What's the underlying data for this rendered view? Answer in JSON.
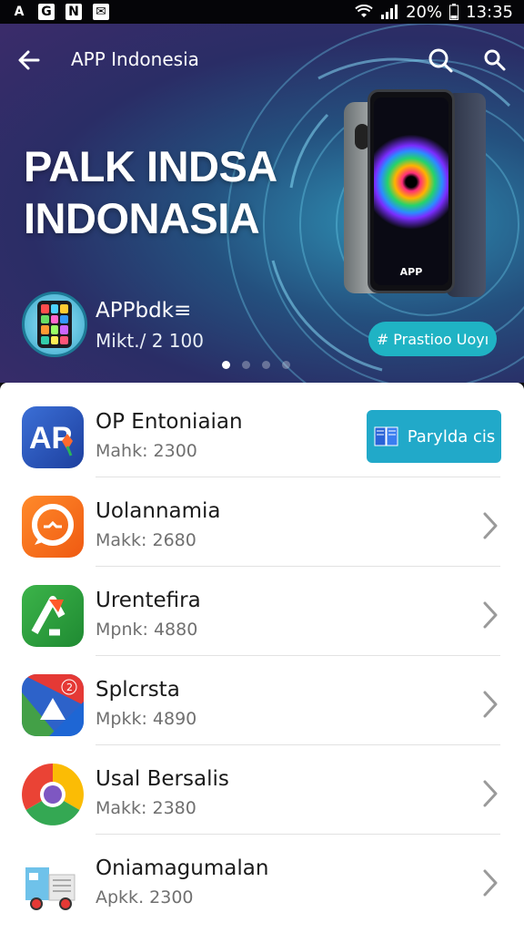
{
  "status_bar": {
    "battery": "20%",
    "time": "13:35",
    "left_icons": [
      "A",
      "G",
      "N",
      "M"
    ]
  },
  "header": {
    "title": "APP Indonesia"
  },
  "hero": {
    "title_line1": "PALK INDSA",
    "title_line2": "INDONASIA",
    "phone_label": "APP",
    "app_name": "APPbdk≡",
    "app_meta": "Mikt./ 2 100",
    "cta_label": "# Prastioo Uoyı",
    "carousel_active": 1,
    "carousel_total": 4
  },
  "apps": [
    {
      "name": "OP Entoniaian",
      "meta": "Mahk: 2300",
      "action": "Parylda cis",
      "icon": "ap-logo-icon"
    },
    {
      "name": "Uolannamia",
      "meta": "Makk: 2680",
      "icon": "orange-chat-icon"
    },
    {
      "name": "Urentefira",
      "meta": "Mpnk: 4880",
      "icon": "green-arrow-icon"
    },
    {
      "name": "Splcrsta",
      "meta": "Mpkk: 4890",
      "icon": "multicolor-triangle-icon"
    },
    {
      "name": "Usal Bersalis",
      "meta": "Makk: 2380",
      "icon": "chrome-like-icon"
    },
    {
      "name": "Oniamagumalan",
      "meta": "Apkk. 2300",
      "icon": "truck-icon"
    }
  ],
  "colors": {
    "accent": "#21a9c9",
    "hero_cta": "#1fb3c4",
    "status_bar_bg": "#050508"
  }
}
